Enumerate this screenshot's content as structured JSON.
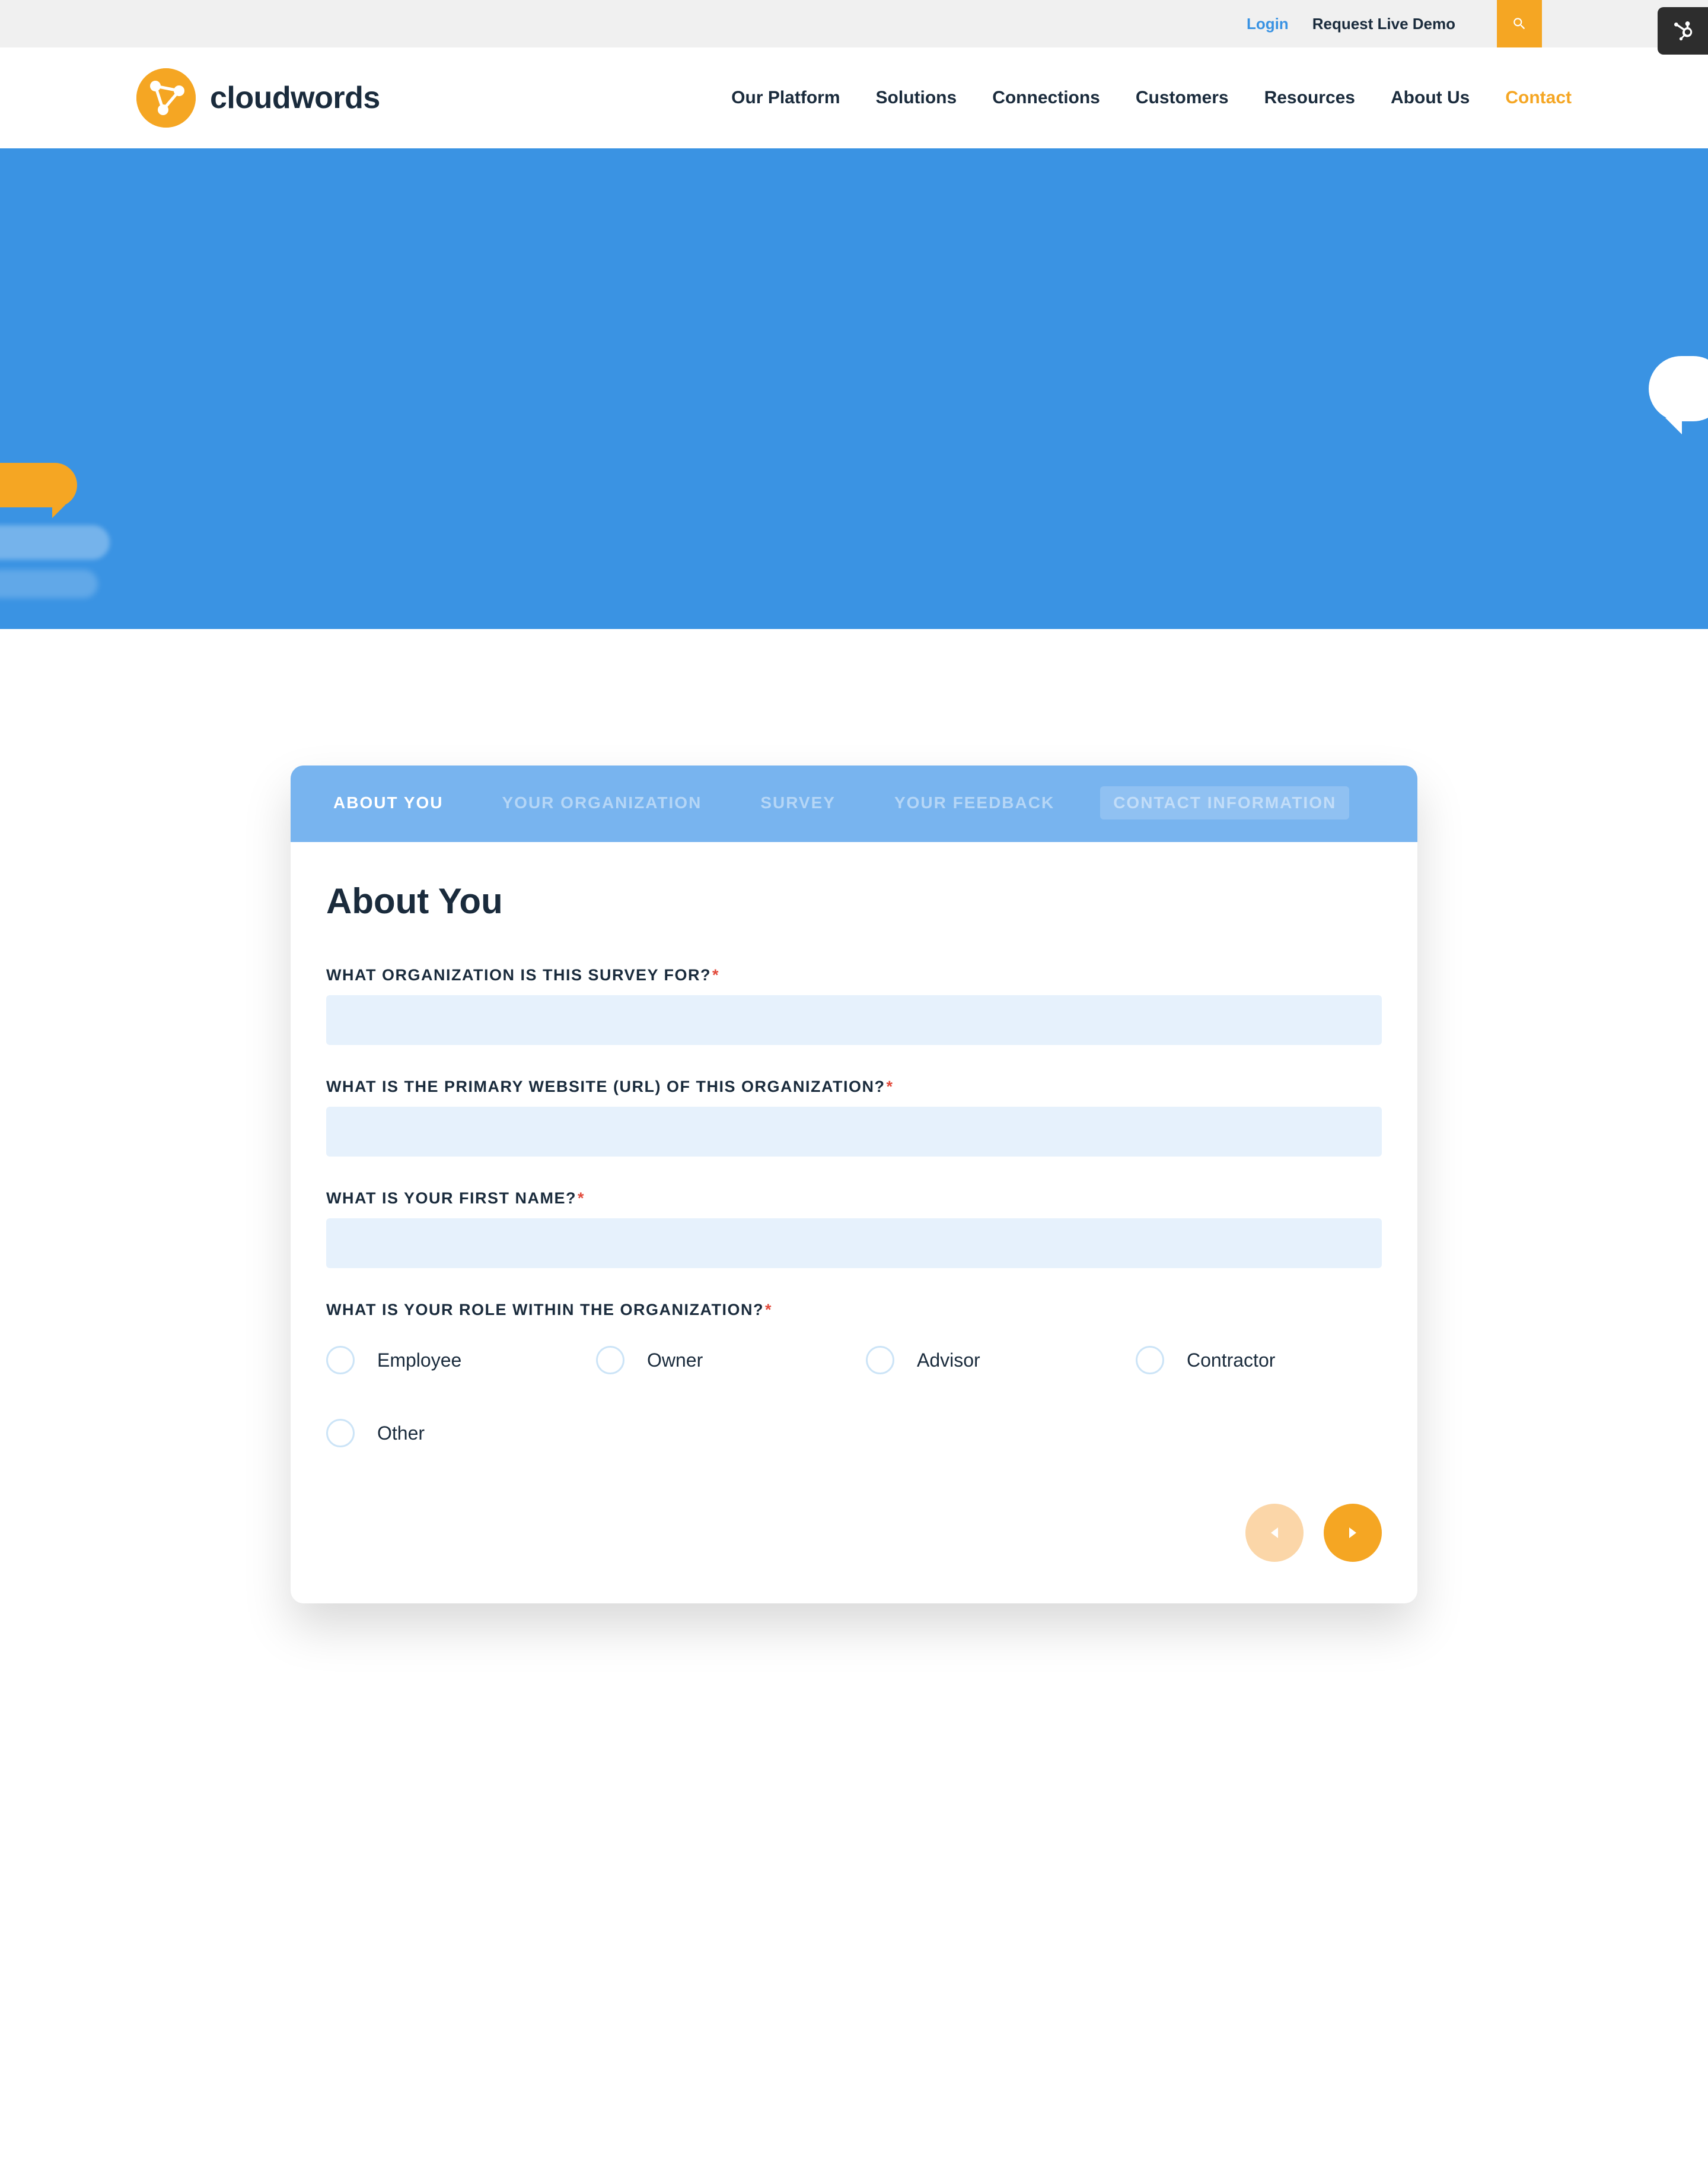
{
  "topbar": {
    "login": "Login",
    "demo": "Request Live Demo"
  },
  "brand": {
    "name": "cloudwords"
  },
  "nav": {
    "items": [
      {
        "label": "Our Platform",
        "active": false
      },
      {
        "label": "Solutions",
        "active": false
      },
      {
        "label": "Connections",
        "active": false
      },
      {
        "label": "Customers",
        "active": false
      },
      {
        "label": "Resources",
        "active": false
      },
      {
        "label": "About Us",
        "active": false
      },
      {
        "label": "Contact",
        "active": true
      }
    ]
  },
  "form": {
    "tabs": [
      {
        "label": "ABOUT YOU",
        "active": true
      },
      {
        "label": "YOUR ORGANIZATION",
        "active": false
      },
      {
        "label": "SURVEY",
        "active": false
      },
      {
        "label": "YOUR FEEDBACK",
        "active": false
      },
      {
        "label": "CONTACT INFORMATION",
        "active": false
      }
    ],
    "title": "About You",
    "fields": {
      "org": {
        "label": "WHAT ORGANIZATION IS THIS SURVEY FOR?",
        "required": true,
        "value": ""
      },
      "url": {
        "label": "WHAT IS THE PRIMARY WEBSITE (URL) OF THIS ORGANIZATION?",
        "required": true,
        "value": ""
      },
      "firstName": {
        "label": "WHAT IS YOUR FIRST NAME?",
        "required": true,
        "value": ""
      },
      "role": {
        "label": "WHAT IS YOUR ROLE WITHIN THE ORGANIZATION?",
        "required": true,
        "options": [
          "Employee",
          "Owner",
          "Advisor",
          "Contractor",
          "Other"
        ]
      }
    }
  }
}
